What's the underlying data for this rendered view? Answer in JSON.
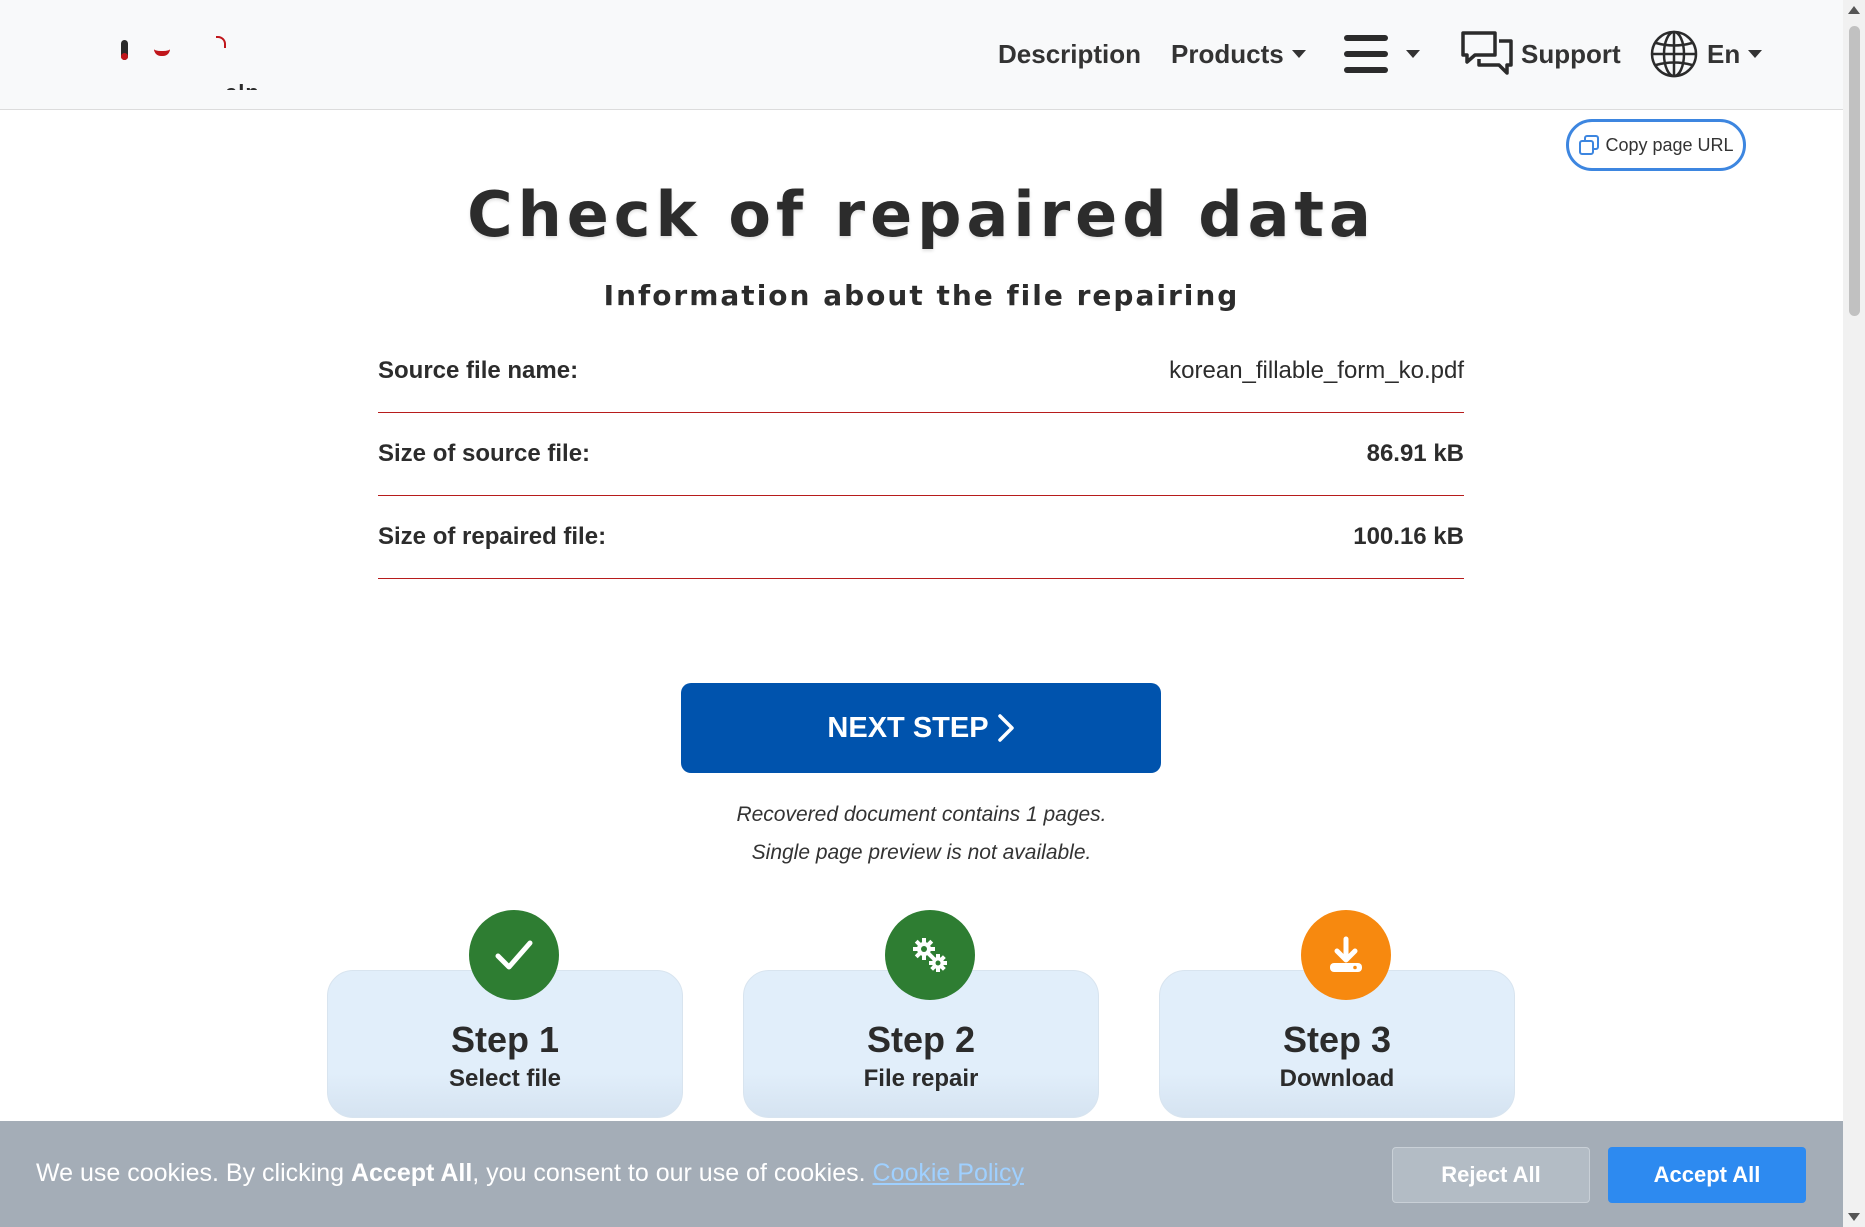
{
  "header": {
    "nav": {
      "description": "Description",
      "products": "Products",
      "support": "Support",
      "language": "En"
    }
  },
  "copy_url": {
    "label": "Copy page URL"
  },
  "main": {
    "title": "Check of repaired data",
    "subtitle": "Information about the file repairing",
    "info_rows": [
      {
        "label": "Source file name:",
        "value": "korean_fillable_form_ko.pdf"
      },
      {
        "label": "Size of source file:",
        "value": "86.91 kB"
      },
      {
        "label": "Size of repaired file:",
        "value": "100.16 kB"
      }
    ],
    "next_button": "NEXT STEP",
    "note_pages": "Recovered document contains 1 pages.",
    "note_preview": "Single page preview is not available."
  },
  "steps": [
    {
      "title": "Step 1",
      "subtitle": "Select file",
      "icon": "checkmark-icon",
      "color": "#2e7d32"
    },
    {
      "title": "Step 2",
      "subtitle": "File repair",
      "icon": "gears-icon",
      "color": "#2e7d32"
    },
    {
      "title": "Step 3",
      "subtitle": "Download",
      "icon": "download-icon",
      "color": "#f7890f"
    }
  ],
  "cookie": {
    "text_prefix": "We use cookies. By clicking ",
    "text_bold": "Accept All",
    "text_suffix": ", you consent to our use of cookies. ",
    "link": "Cookie Policy",
    "reject": "Reject All",
    "accept": "Accept All"
  },
  "colors": {
    "primary_button": "#0053ad",
    "accept_button": "#2d8af0",
    "divider": "#b71c1c",
    "step_done": "#2e7d32",
    "step_pending": "#f7890f"
  }
}
